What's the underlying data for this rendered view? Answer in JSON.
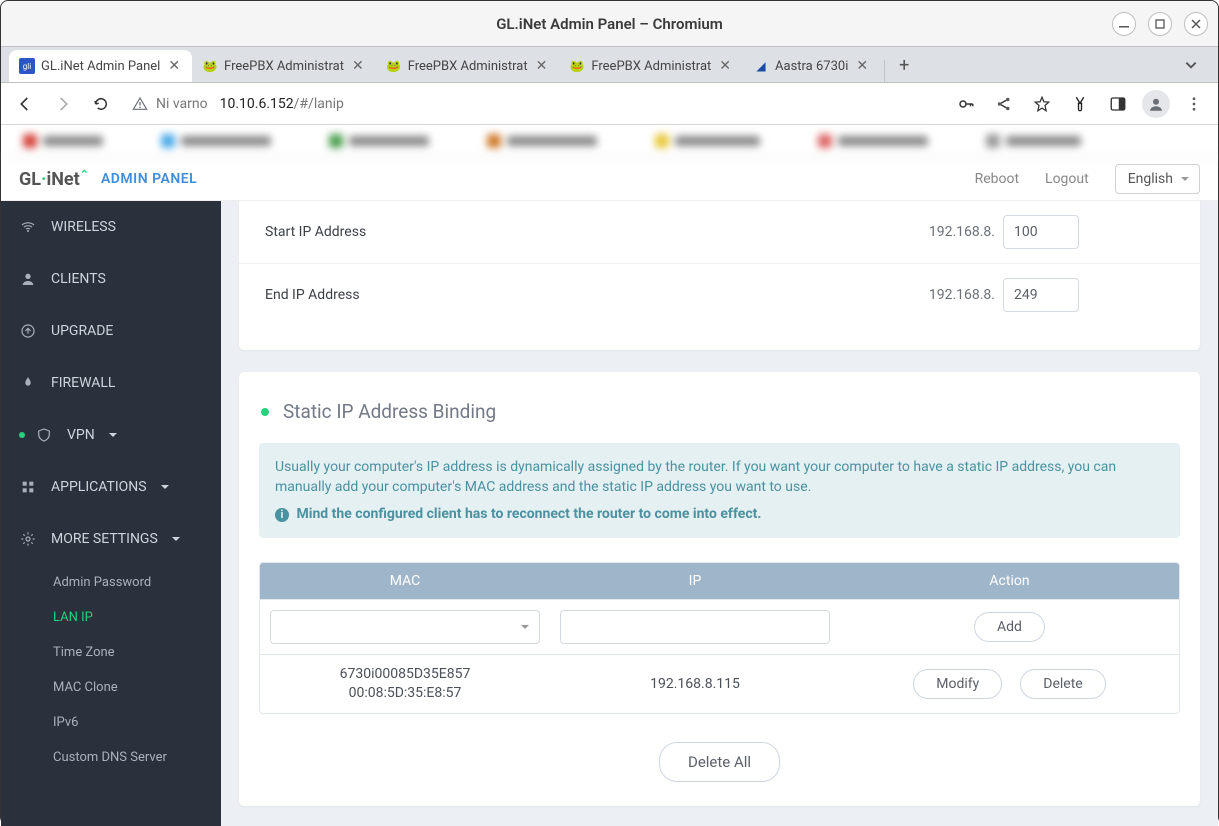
{
  "os": {
    "title": "GL.iNet Admin Panel – Chromium"
  },
  "tabs": [
    {
      "title": "GL.iNet Admin Panel",
      "favicon_bg": "#2a56c6",
      "favicon_text": "gli",
      "active": true
    },
    {
      "title": "FreePBX Administrat",
      "favicon": "🐸"
    },
    {
      "title": "FreePBX Administrat",
      "favicon": "🐸"
    },
    {
      "title": "FreePBX Administrat",
      "favicon": "🐸"
    },
    {
      "title": "Aastra 6730i",
      "favicon": "📘"
    }
  ],
  "toolbar": {
    "insecure_label": "Ni varno",
    "url_host": "10.10.6.152",
    "url_path": "/#/lanip"
  },
  "ap_header": {
    "logo": "GL·iNet",
    "sublabel": "ADMIN PANEL",
    "reboot": "Reboot",
    "logout": "Logout",
    "language": "English"
  },
  "sidebar": {
    "wireless": "WIRELESS",
    "clients": "CLIENTS",
    "upgrade": "UPGRADE",
    "firewall": "FIREWALL",
    "vpn": "VPN",
    "applications": "APPLICATIONS",
    "more": "MORE SETTINGS",
    "sub": {
      "admin_pw": "Admin Password",
      "lan_ip": "LAN IP",
      "time_zone": "Time Zone",
      "mac_clone": "MAC Clone",
      "ipv6": "IPv6",
      "custom_dns": "Custom DNS Server"
    }
  },
  "dhcp": {
    "start_label": "Start IP Address",
    "end_label": "End IP Address",
    "prefix": "192.168.8.",
    "start": "100",
    "end": "249"
  },
  "static_binding": {
    "title": "Static IP Address Binding",
    "info1": "Usually your computer's IP address is dynamically assigned by the router. If you want your computer to have a static IP address, you can manually add your computer's MAC address and the static IP address you want to use.",
    "info2": "Mind the configured client has to reconnect the router to come into effect.",
    "cols": {
      "mac": "MAC",
      "ip": "IP",
      "action": "Action"
    },
    "add_label": "Add",
    "modify_label": "Modify",
    "delete_label": "Delete",
    "delete_all_label": "Delete All",
    "rows": [
      {
        "name": "6730i00085D35E857",
        "mac": "00:08:5D:35:E8:57",
        "ip": "192.168.8.115"
      }
    ]
  }
}
